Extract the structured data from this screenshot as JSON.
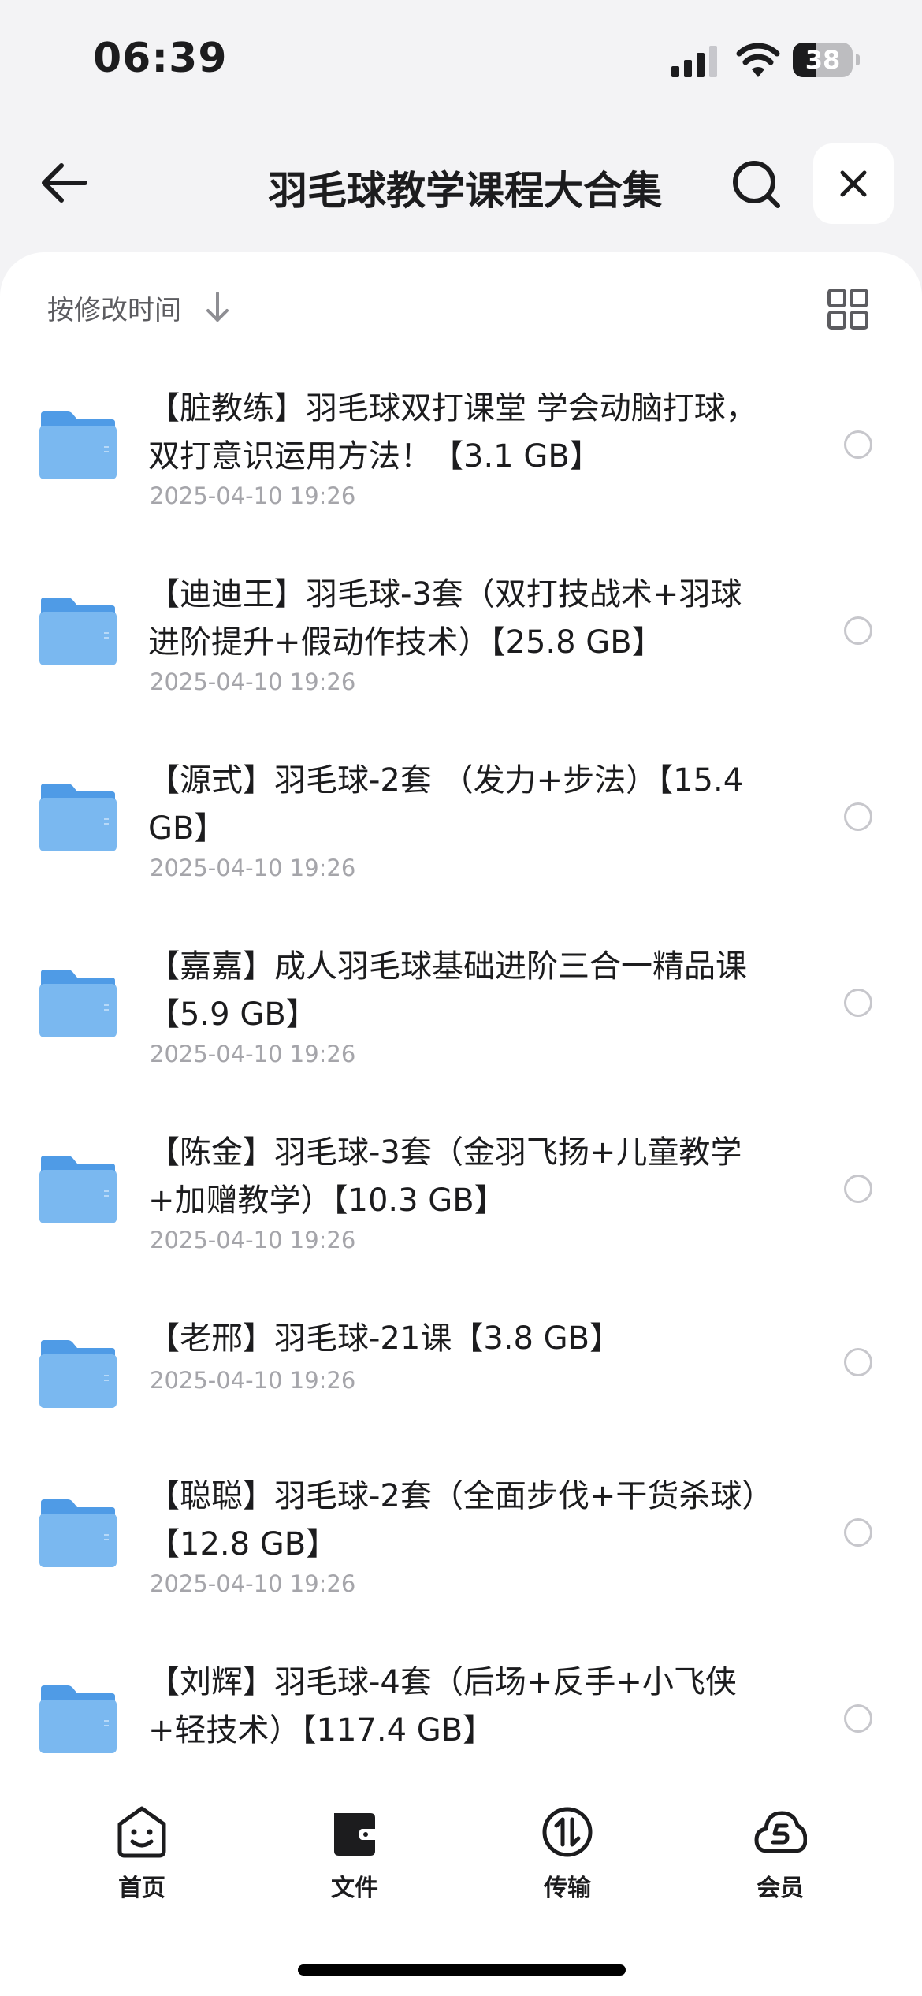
{
  "status_bar": {
    "time": "06:39",
    "battery_level": "38",
    "battery_percent": 38
  },
  "header": {
    "title": "羽毛球教学课程大合集",
    "back_icon": "arrow-left-icon",
    "search_icon": "search-icon",
    "close_icon": "close-icon"
  },
  "toolbar": {
    "sort_label": "按修改时间",
    "sort_icon": "arrow-down-icon",
    "view_icon": "grid-view-icon"
  },
  "files": [
    {
      "name": "【脏教练】羽毛球双打课堂 学会动脑打球，双打意识运用方法！【3.1 GB】",
      "date": "2025-04-10 19:26"
    },
    {
      "name": "【迪迪王】羽毛球-3套（双打技战术+羽球进阶提升+假动作技术）【25.8 GB】",
      "date": "2025-04-10 19:26"
    },
    {
      "name": "【源式】羽毛球-2套 （发力+步法）【15.4 GB】",
      "date": "2025-04-10 19:26"
    },
    {
      "name": "【嘉嘉】成人羽毛球基础进阶三合一精品课【5.9 GB】",
      "date": "2025-04-10 19:26"
    },
    {
      "name": "【陈金】羽毛球-3套（金羽飞扬+儿童教学+加赠教学）【10.3 GB】",
      "date": "2025-04-10 19:26"
    },
    {
      "name": "【老邢】羽毛球-21课【3.8 GB】",
      "date": "2025-04-10 19:26"
    },
    {
      "name": "【聪聪】羽毛球-2套（全面步伐+干货杀球）【12.8 GB】",
      "date": "2025-04-10 19:26"
    },
    {
      "name": "【刘辉】羽毛球-4套（后场+反手+小飞侠+轻技术）【117.4 GB】",
      "date": ""
    }
  ],
  "tab_bar": {
    "items": [
      {
        "label": "首页",
        "icon": "home-face-icon",
        "active": false
      },
      {
        "label": "文件",
        "icon": "wallet-folder-icon",
        "active": true
      },
      {
        "label": "传输",
        "icon": "transfer-icon",
        "active": false
      },
      {
        "label": "会员",
        "icon": "cloud-member-icon",
        "active": false
      }
    ]
  },
  "colors": {
    "background": "#f3f3f5",
    "card": "#ffffff",
    "folder_blue": "#7ab8f0",
    "text_primary": "#1c1c1e",
    "text_secondary": "#a5a5aa"
  }
}
